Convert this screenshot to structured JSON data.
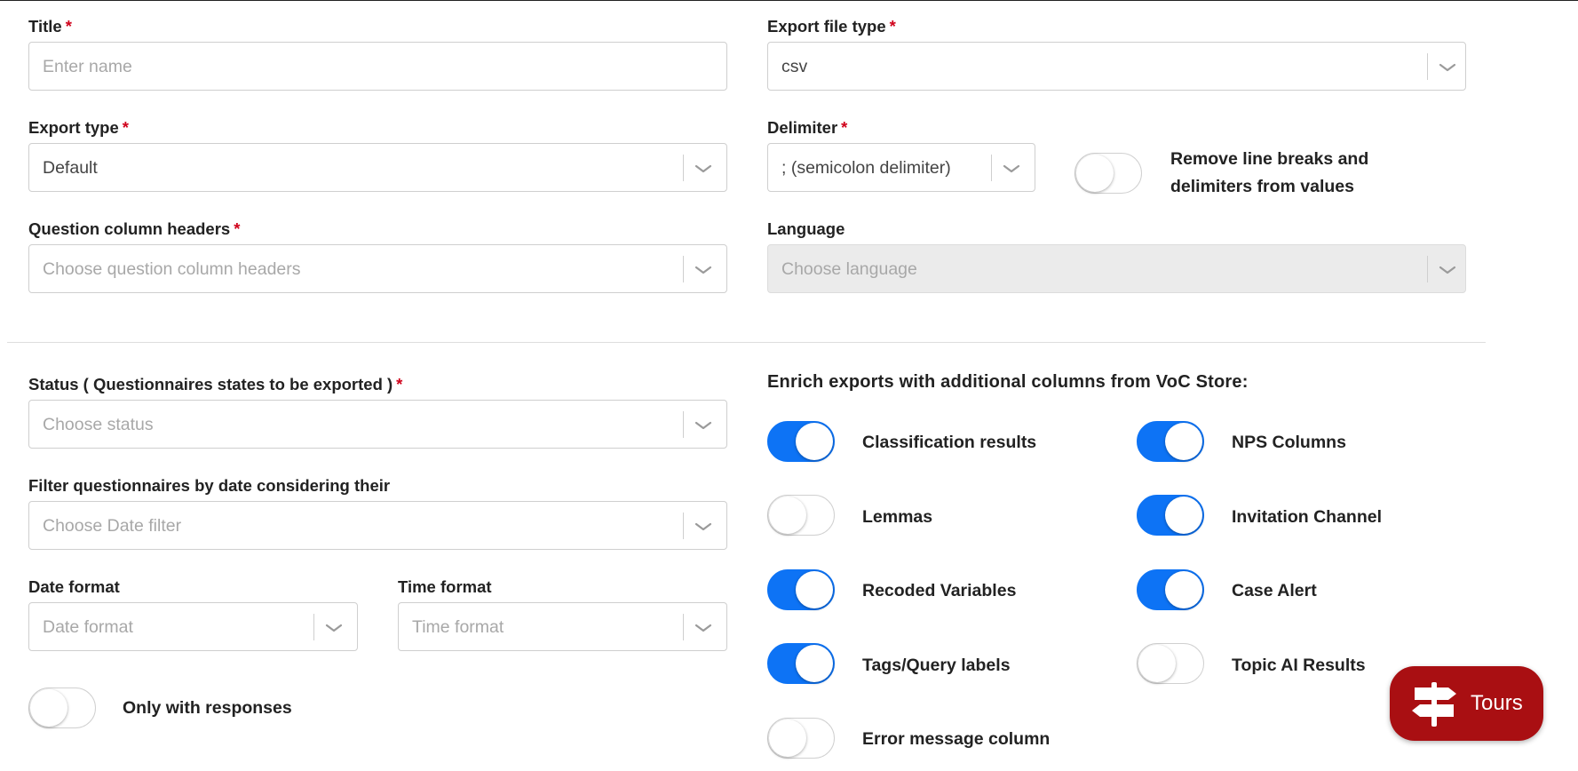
{
  "form": {
    "title": {
      "label": "Title",
      "required": "*",
      "placeholder": "Enter name"
    },
    "export_file_type": {
      "label": "Export file type",
      "required": "*",
      "value": "csv"
    },
    "export_type": {
      "label": "Export type",
      "required": "*",
      "value": "Default"
    },
    "delimiter": {
      "label": "Delimiter",
      "required": "*",
      "value": "; (semicolon delimiter)"
    },
    "remove_line_breaks": {
      "label_line1": "Remove line breaks and",
      "label_line2": "delimiters from values",
      "on": false
    },
    "question_headers": {
      "label": "Question column headers",
      "required": "*",
      "placeholder": "Choose question column headers"
    },
    "language": {
      "label": "Language",
      "placeholder": "Choose language",
      "disabled": true
    },
    "status": {
      "label": "Status ( Questionnaires states to be exported )",
      "required": "*",
      "placeholder": "Choose status"
    },
    "date_filter": {
      "label": "Filter questionnaires by date considering their",
      "placeholder": "Choose Date filter"
    },
    "date_format": {
      "label": "Date format",
      "placeholder": "Date format"
    },
    "time_format": {
      "label": "Time format",
      "placeholder": "Time format"
    },
    "only_with_responses": {
      "label": "Only with responses",
      "on": false
    }
  },
  "enrich": {
    "title": "Enrich exports with additional columns from VoC Store:",
    "options": [
      {
        "label": "Classification results",
        "on": true
      },
      {
        "label": "NPS Columns",
        "on": true
      },
      {
        "label": "Lemmas",
        "on": false
      },
      {
        "label": "Invitation Channel",
        "on": true
      },
      {
        "label": "Recoded Variables",
        "on": true
      },
      {
        "label": "Case Alert",
        "on": true
      },
      {
        "label": "Tags/Query labels",
        "on": true
      },
      {
        "label": "Topic AI Results",
        "on": false
      },
      {
        "label": "Error message column",
        "on": false
      }
    ]
  },
  "tours": {
    "label": "Tours",
    "icon": "signpost-icon"
  },
  "colors": {
    "accent": "#0d73f5",
    "required": "#d0021b",
    "tours_bg": "#a90f12",
    "disabled_bg": "#ebebeb"
  }
}
